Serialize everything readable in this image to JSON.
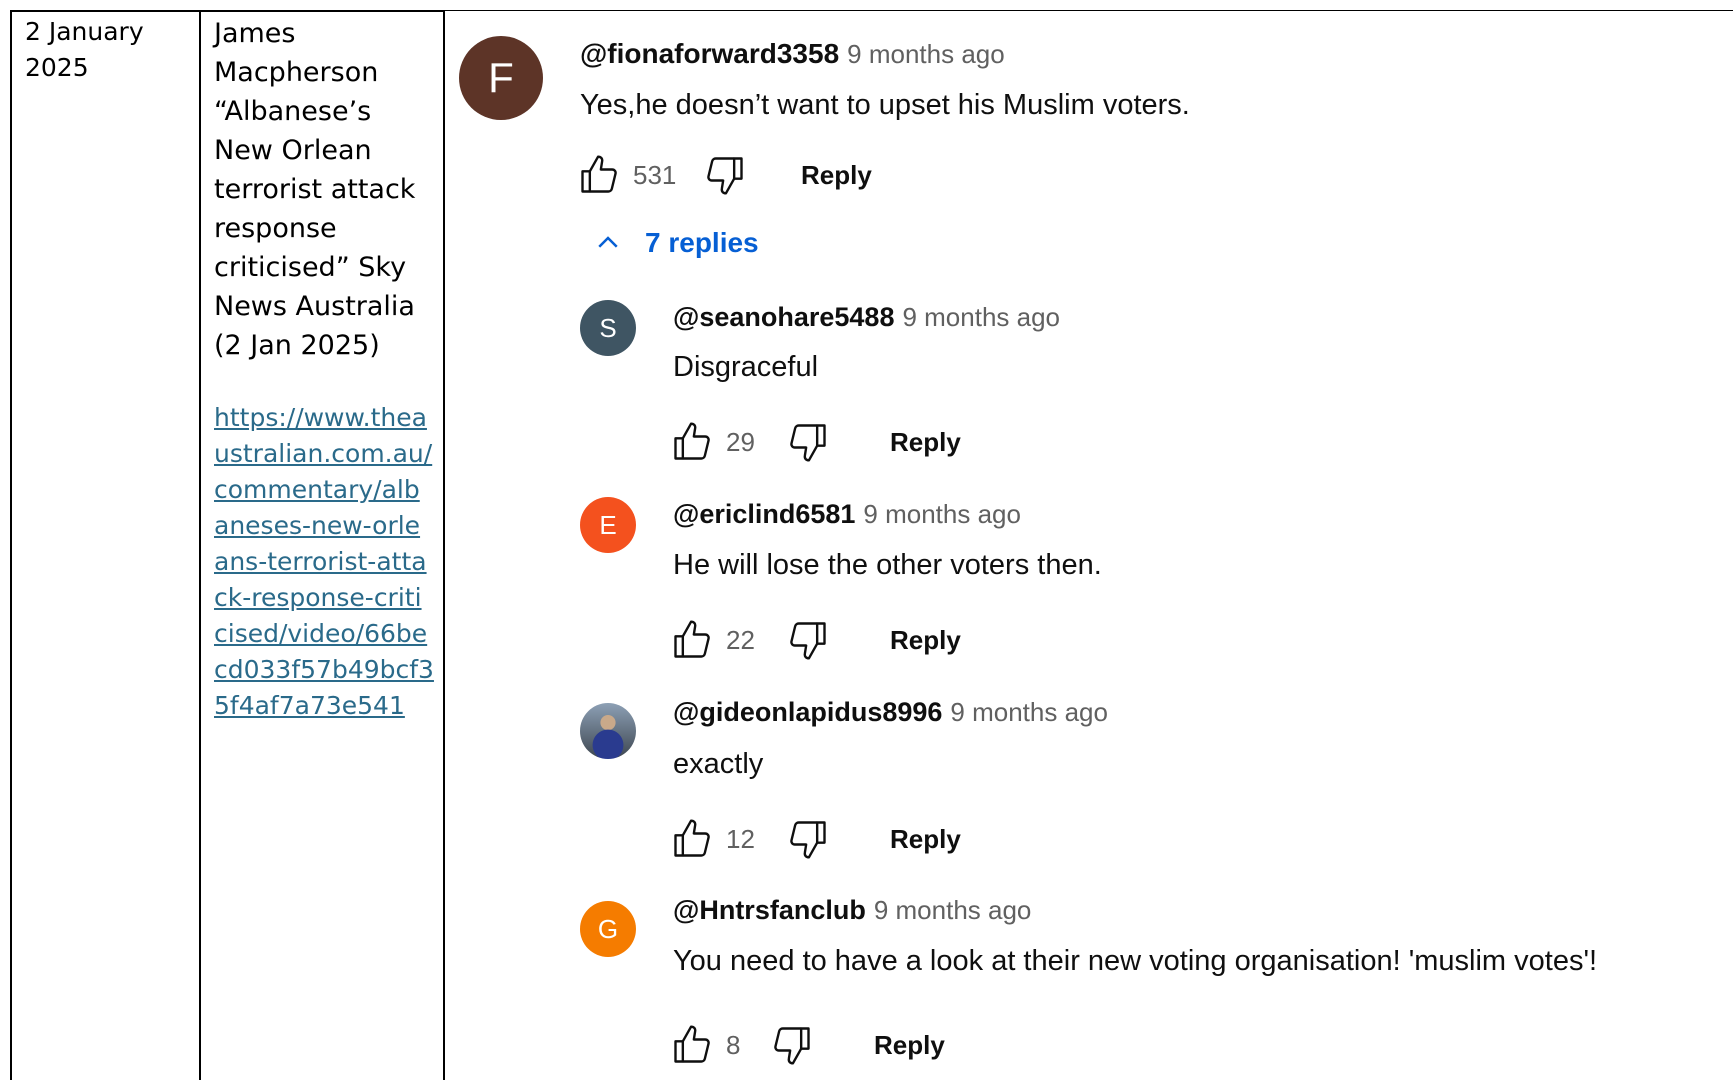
{
  "row": {
    "date": "2 January 2025",
    "source": "James Macpherson “Albanese’s New Orlean terrorist attack response criticised” Sky News Australia (2 Jan 2025)",
    "url": "https://www.theaustralian.com.au/commentary/albaneses-new-orleans-terrorist-attack-response-criticised/video/66becd033f57b49bcf35f4af7a73e541"
  },
  "comment": {
    "avatar_letter": "F",
    "avatar_color": "#5d3427",
    "handle": "@fionaforward3358",
    "time": "9 months ago",
    "text": "Yes,he doesn’t want to upset his Muslim voters.",
    "likes": "531",
    "reply_label": "Reply",
    "replies_toggle": "7 replies"
  },
  "replies": [
    {
      "avatar_letter": "S",
      "avatar_color": "#3f5563",
      "handle": "@seanohare5488",
      "time": "9 months ago",
      "text": "Disgraceful",
      "likes": "29",
      "reply_label": "Reply"
    },
    {
      "avatar_letter": "E",
      "avatar_color": "#f4511e",
      "handle": "@ericlind6581",
      "time": "9 months ago",
      "text": "He will lose the other voters then.",
      "likes": "22",
      "reply_label": "Reply"
    },
    {
      "avatar_letter": "",
      "avatar_color": "#4a5a6a",
      "handle": "@gideonlapidus8996",
      "time": "9 months ago",
      "text": "exactly",
      "likes": "12",
      "reply_label": "Reply"
    },
    {
      "avatar_letter": "G",
      "avatar_color": "#f57c00",
      "handle": "@Hntrsfanclub",
      "time": "9 months ago",
      "text": "You need to have a look at their new voting organisation!  'muslim votes'!",
      "likes": "8",
      "reply_label": "Reply"
    }
  ]
}
